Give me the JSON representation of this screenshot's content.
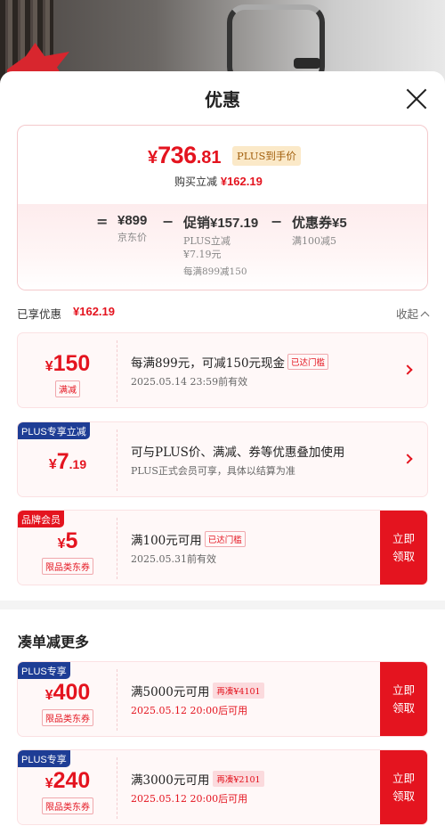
{
  "sheet": {
    "title": "优惠"
  },
  "price_box": {
    "yen": "¥",
    "final_int": "736",
    "final_dec": ".81",
    "plus_tag": "PLUS到手价",
    "buy_save_label": "购买立减",
    "buy_save_value": "¥162.19",
    "equals": "=",
    "jd_price": "¥899",
    "jd_label": "京东价",
    "minus": "−",
    "promo_main": "促销¥157.19",
    "promo_sub1": "PLUS立减",
    "promo_sub2": "¥7.19元",
    "coupon_main": "优惠券¥5",
    "coupon_sub": "满100减5",
    "promo_note": "每满899减150"
  },
  "enjoyed": {
    "label": "已享优惠",
    "value": "¥162.19",
    "collapse_label": "收起"
  },
  "cards": [
    {
      "badge": "",
      "yen": "¥",
      "amount": "150",
      "amount_dec": "",
      "tag": "满减",
      "title": "每满899元，可减150元现金",
      "title_tag": "已达门槛",
      "sub": "2025.05.14  23:59前有效"
    },
    {
      "badge": "PLUS专享立减",
      "yen": "¥",
      "amount": "7",
      "amount_dec": ".19",
      "tag": "",
      "title": "可与PLUS价、满减、券等优惠叠加使用",
      "title_tag": "",
      "sub": "PLUS正式会员可享，具体以结算为准"
    },
    {
      "badge": "品牌会员",
      "yen": "¥",
      "amount": "5",
      "amount_dec": "",
      "tag": "限品类东券",
      "title": "满100元可用",
      "title_tag": "已达门槛",
      "sub": "2025.05.31前有效",
      "button": "立即领取"
    }
  ],
  "more_section": {
    "title": "凑单减更多",
    "cards": [
      {
        "badge": "PLUS专享",
        "yen": "¥",
        "amount": "400",
        "tag": "限品类东券",
        "title": "满5000元可用",
        "title_tag": "再凑¥4101",
        "sub": "2025.05.12  20:00后可用",
        "button": "立即领取"
      },
      {
        "badge": "PLUS专享",
        "yen": "¥",
        "amount": "240",
        "tag": "限品类东券",
        "title": "满3000元可用",
        "title_tag": "再凑¥2101",
        "sub": "2025.05.12  20:00后可用",
        "button": "立即领取"
      }
    ]
  },
  "colors": {
    "accent_red": "#e4141f",
    "plus_blue": "#1e3d95",
    "plus_gold_bg": "#fbe9c8"
  }
}
